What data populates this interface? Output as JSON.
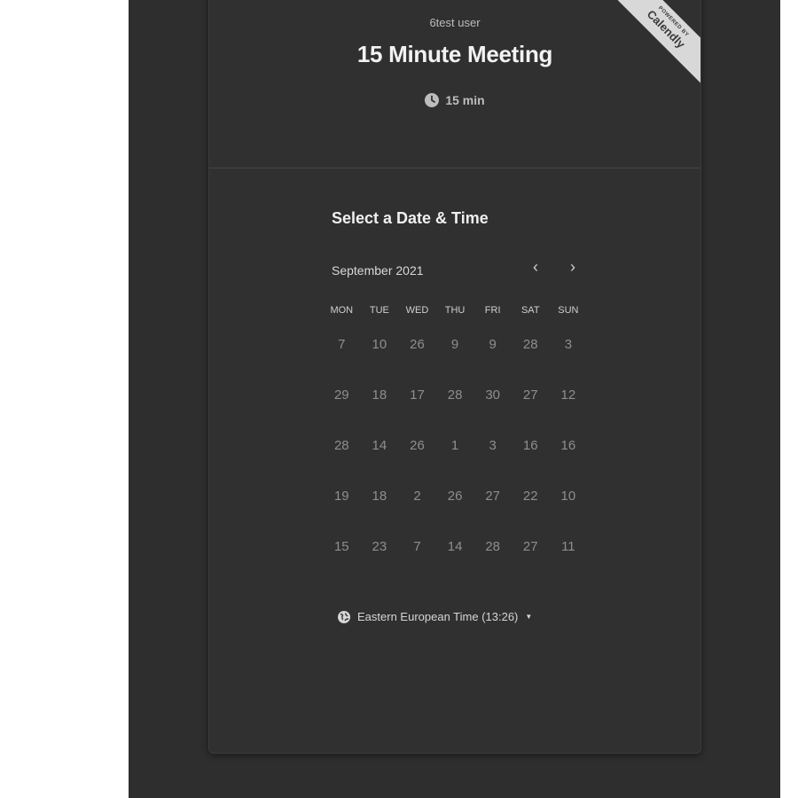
{
  "header": {
    "owner": "6test user",
    "title": "15 Minute Meeting",
    "duration": "15 min",
    "ribbon_small": "POWERED BY",
    "ribbon_brand": "Calendly"
  },
  "picker": {
    "heading": "Select a Date & Time",
    "month_label": "September 2021",
    "prev_icon": "chevron-left-icon",
    "next_icon": "chevron-right-icon",
    "weekdays": [
      "MON",
      "TUE",
      "WED",
      "THU",
      "FRI",
      "SAT",
      "SUN"
    ],
    "weeks": [
      [
        "7",
        "10",
        "26",
        "9",
        "9",
        "28",
        "3"
      ],
      [
        "29",
        "18",
        "17",
        "28",
        "30",
        "27",
        "12"
      ],
      [
        "28",
        "14",
        "26",
        "1",
        "3",
        "16",
        "16"
      ],
      [
        "19",
        "18",
        "2",
        "26",
        "27",
        "22",
        "10"
      ],
      [
        "15",
        "23",
        "7",
        "14",
        "28",
        "27",
        "11"
      ]
    ]
  },
  "timezone": {
    "label": "Eastern European Time (13:26)",
    "icon": "globe-icon"
  },
  "colors": {
    "background": "#2e2e2e",
    "card": "#303030",
    "text": "#f2f2f2",
    "muted_day": "#8e8e8e"
  }
}
